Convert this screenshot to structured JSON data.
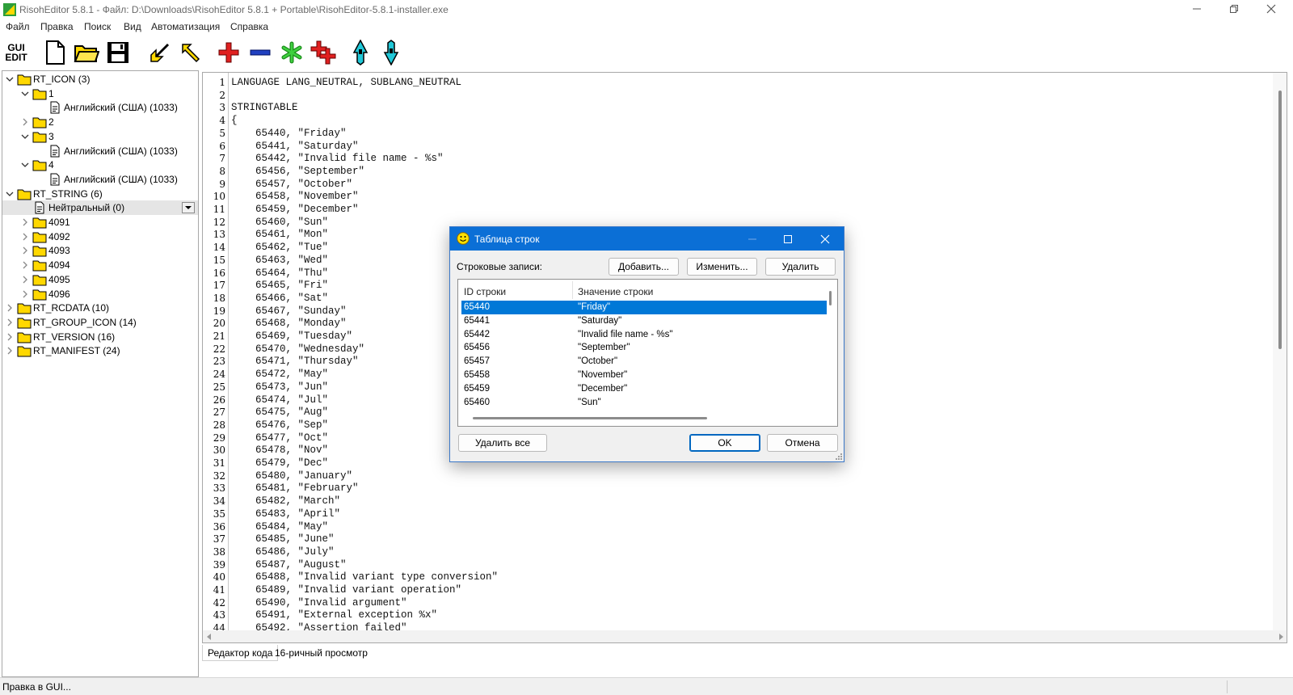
{
  "window": {
    "title": "RisohEditor 5.8.1 - Файл: D:\\Downloads\\RisohEditor 5.8.1 + Portable\\RisohEditor-5.8.1-installer.exe"
  },
  "menu": [
    "Файл",
    "Правка",
    "Поиск",
    "Вид",
    "Автоматизация",
    "Справка"
  ],
  "toolbar": {
    "gui_edit_label": [
      "GUI",
      "EDIT"
    ],
    "buttons": [
      "new-file-icon",
      "open-folder-icon",
      "save-icon",
      "arrow-down-left-icon",
      "arrow-up-left-icon",
      "plus-icon",
      "minus-icon",
      "asterisk-icon",
      "add-multiple-icon",
      "move-up-icon",
      "move-down-icon"
    ]
  },
  "tree": [
    {
      "label": "RT_ICON (3)",
      "expanded": true
    },
    {
      "label": "1",
      "expanded": true
    },
    {
      "label": "Английский (США) (1033)"
    },
    {
      "label": "2",
      "expanded": false
    },
    {
      "label": "3",
      "expanded": true
    },
    {
      "label": "Английский (США) (1033)"
    },
    {
      "label": "4",
      "expanded": true
    },
    {
      "label": "Английский (США) (1033)"
    },
    {
      "label": "RT_STRING (6)",
      "expanded": true
    },
    {
      "label": "Нейтральный (0)",
      "selected": true
    },
    {
      "label": "4091"
    },
    {
      "label": "4092"
    },
    {
      "label": "4093"
    },
    {
      "label": "4094"
    },
    {
      "label": "4095"
    },
    {
      "label": "4096"
    },
    {
      "label": "RT_RCDATA (10)"
    },
    {
      "label": "RT_GROUP_ICON (14)"
    },
    {
      "label": "RT_VERSION (16)"
    },
    {
      "label": "RT_MANIFEST (24)"
    }
  ],
  "editor": {
    "line_numbers": [
      "1",
      "2",
      "3",
      "4",
      "5",
      "6",
      "7",
      "8",
      "9",
      "10",
      "11",
      "12",
      "13",
      "14",
      "15",
      "16",
      "17",
      "18",
      "19",
      "20",
      "21",
      "22",
      "23",
      "24",
      "25",
      "26",
      "27",
      "28",
      "29",
      "30",
      "31",
      "32",
      "33",
      "34",
      "35",
      "36",
      "37",
      "38",
      "39",
      "40",
      "41",
      "42",
      "43",
      "44"
    ],
    "lines": [
      "LANGUAGE LANG_NEUTRAL, SUBLANG_NEUTRAL",
      "",
      "STRINGTABLE",
      "{",
      "    65440, \"Friday\"",
      "    65441, \"Saturday\"",
      "    65442, \"Invalid file name - %s\"",
      "    65456, \"September\"",
      "    65457, \"October\"",
      "    65458, \"November\"",
      "    65459, \"December\"",
      "    65460, \"Sun\"",
      "    65461, \"Mon\"",
      "    65462, \"Tue\"",
      "    65463, \"Wed\"",
      "    65464, \"Thu\"",
      "    65465, \"Fri\"",
      "    65466, \"Sat\"",
      "    65467, \"Sunday\"",
      "    65468, \"Monday\"",
      "    65469, \"Tuesday\"",
      "    65470, \"Wednesday\"",
      "    65471, \"Thursday\"",
      "    65472, \"May\"",
      "    65473, \"Jun\"",
      "    65474, \"Jul\"",
      "    65475, \"Aug\"",
      "    65476, \"Sep\"",
      "    65477, \"Oct\"",
      "    65478, \"Nov\"",
      "    65479, \"Dec\"",
      "    65480, \"January\"",
      "    65481, \"February\"",
      "    65482, \"March\"",
      "    65483, \"April\"",
      "    65484, \"May\"",
      "    65485, \"June\"",
      "    65486, \"July\"",
      "    65487, \"August\"",
      "    65488, \"Invalid variant type conversion\"",
      "    65489, \"Invalid variant operation\"",
      "    65490, \"Invalid argument\"",
      "    65491, \"External exception %x\"",
      "    65492, \"Assertion failed\""
    ]
  },
  "tabs": [
    "Редактор кода",
    "16-ричный просмотр"
  ],
  "status": {
    "text": "Правка в GUI..."
  },
  "dialog": {
    "title": "Таблица строк",
    "label": "Строковые записи:",
    "add_button": "Добавить...",
    "edit_button": "Изменить...",
    "delete_button": "Удалить",
    "columns": [
      "ID строки",
      "Значение строки"
    ],
    "rows": [
      {
        "id": "65440",
        "value": "\"Friday\"",
        "selected": true
      },
      {
        "id": "65441",
        "value": "\"Saturday\""
      },
      {
        "id": "65442",
        "value": "\"Invalid file name - %s\""
      },
      {
        "id": "65456",
        "value": "\"September\""
      },
      {
        "id": "65457",
        "value": "\"October\""
      },
      {
        "id": "65458",
        "value": "\"November\""
      },
      {
        "id": "65459",
        "value": "\"December\""
      },
      {
        "id": "65460",
        "value": "\"Sun\""
      }
    ],
    "delete_all_button": "Удалить все",
    "ok_button": "OK",
    "cancel_button": "Отмена"
  },
  "colors": {
    "accent": "#0078d7",
    "dialog_title": "#0b6fd6",
    "folder": "#ffd800"
  }
}
